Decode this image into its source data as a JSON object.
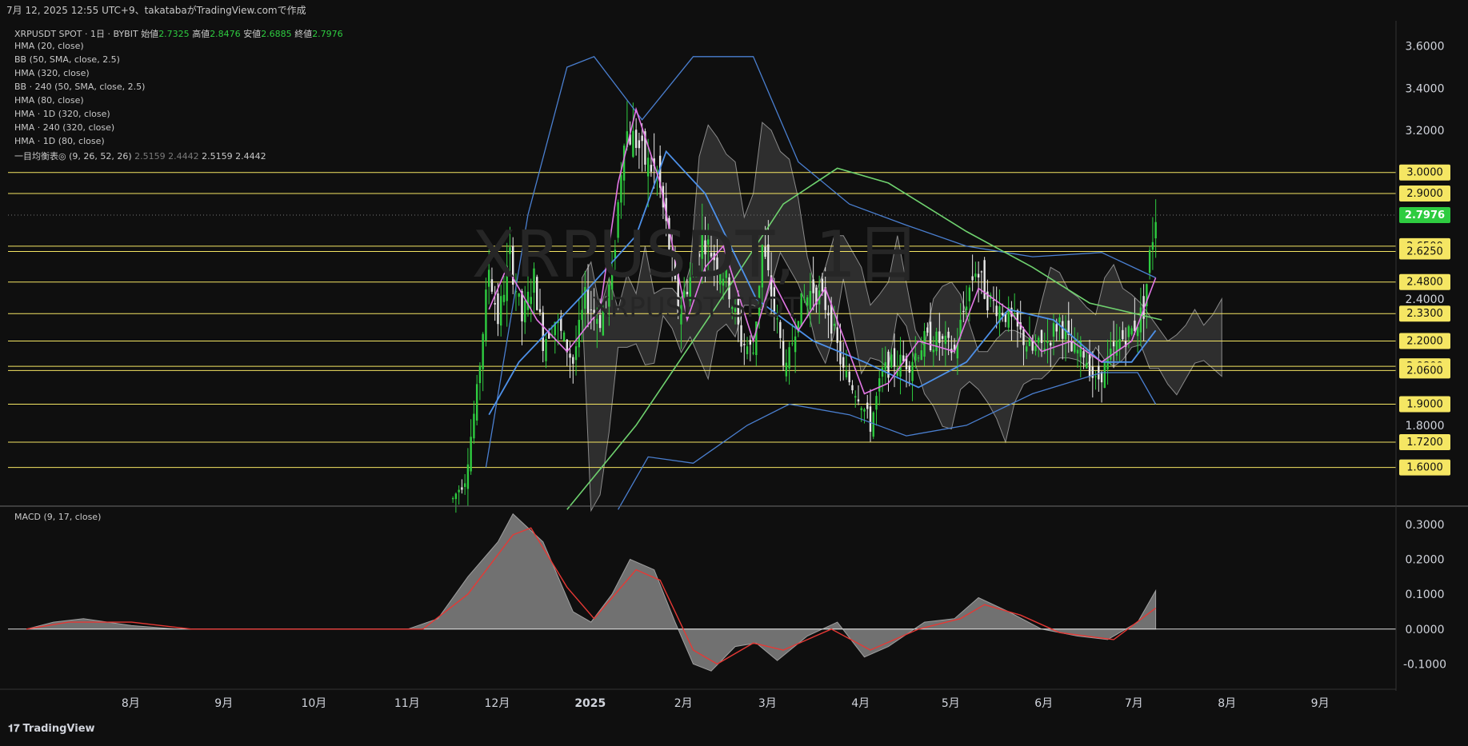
{
  "header": {
    "caption": "7月 12, 2025 12:55 UTC+9、takatabaがTradingView.comで作成"
  },
  "legend": {
    "symbol": "XRPUSDT SPOT · 1日 · BYBIT",
    "open_label": "始値",
    "open": "2.7325",
    "high_label": "高値",
    "high": "2.8476",
    "low_label": "安値",
    "low": "2.6885",
    "close_label": "終値",
    "close": "2.7976",
    "indicators": [
      "HMA (20, close)",
      "BB (50, SMA, close, 2.5)",
      "HMA (320, close)",
      "BB · 240 (50, SMA, close, 2.5)",
      "HMA (80, close)",
      "HMA · 1D (320, close)",
      "HMA · 240 (320, close)",
      "HMA · 1D (80, close)"
    ],
    "ichimoku": {
      "label": "一目均衡表◎ (9, 26, 52, 26)",
      "v1": "2.5159",
      "v2": "2.4442",
      "v3": "2.5159",
      "v4": "2.4442"
    },
    "macd_label": "MACD (9, 17, close)"
  },
  "watermark": {
    "line1": "XRPUSDT, 1日",
    "line2": "XRPUSDT SPOT"
  },
  "footer": {
    "brand": "TradingView"
  },
  "colors": {
    "hline": "#f5e663",
    "up": "#2ecc40",
    "down": "#e8e8e8",
    "hma20": "#e377e6",
    "hma80": "#4d90e8",
    "hma320": "#6fd26f",
    "bb": "#4a7fd0",
    "signal": "#e53935",
    "cloud": "#3a3a3a"
  },
  "chart_data": [
    {
      "type": "candlestick",
      "symbol": "XRPUSDT",
      "x_axis_labels": [
        "8月",
        "9月",
        "10月",
        "11月",
        "12月",
        "2025",
        "2月",
        "3月",
        "4月",
        "5月",
        "6月",
        "7月",
        "8月",
        "9月"
      ],
      "y_axis_ticks": [
        "3.6000",
        "3.4000",
        "3.2000",
        "2.4000",
        "1.8000"
      ],
      "y_range": [
        1.42,
        3.72
      ],
      "price_lines": [
        {
          "value": 3.0,
          "label": "3.0000"
        },
        {
          "value": 2.9,
          "label": "2.9000"
        },
        {
          "value": 2.65,
          "label": "2.6500"
        },
        {
          "value": 2.625,
          "label": "2.6250"
        },
        {
          "value": 2.48,
          "label": "2.4800"
        },
        {
          "value": 2.33,
          "label": "2.3300"
        },
        {
          "value": 2.2,
          "label": "2.2000"
        },
        {
          "value": 2.08,
          "label": "2.0800"
        },
        {
          "value": 2.06,
          "label": "2.0600"
        },
        {
          "value": 1.9,
          "label": "1.9000"
        },
        {
          "value": 1.72,
          "label": "1.7200"
        },
        {
          "value": 1.6,
          "label": "1.6000"
        }
      ],
      "last_price": {
        "value": 2.7976,
        "label": "2.7976"
      },
      "price_path": [
        [
          "2024-11-20",
          1.45
        ],
        [
          "2024-11-24",
          1.55
        ],
        [
          "2024-11-28",
          1.95
        ],
        [
          "2024-12-02",
          2.55
        ],
        [
          "2024-12-05",
          2.3
        ],
        [
          "2024-12-09",
          2.6
        ],
        [
          "2024-12-13",
          2.3
        ],
        [
          "2024-12-17",
          2.5
        ],
        [
          "2024-12-20",
          2.2
        ],
        [
          "2024-12-24",
          2.3
        ],
        [
          "2024-12-30",
          2.1
        ],
        [
          "2025-01-03",
          2.4
        ],
        [
          "2025-01-08",
          2.3
        ],
        [
          "2025-01-12",
          2.5
        ],
        [
          "2025-01-16",
          3.2
        ],
        [
          "2025-01-20",
          3.15
        ],
        [
          "2025-01-23",
          3.05
        ],
        [
          "2025-01-27",
          3.0
        ],
        [
          "2025-01-31",
          2.65
        ],
        [
          "2025-02-03",
          2.35
        ],
        [
          "2025-02-07",
          2.5
        ],
        [
          "2025-02-11",
          2.7
        ],
        [
          "2025-02-15",
          2.6
        ],
        [
          "2025-02-19",
          2.5
        ],
        [
          "2025-02-24",
          2.2
        ],
        [
          "2025-02-28",
          2.15
        ],
        [
          "2025-03-03",
          2.65
        ],
        [
          "2025-03-07",
          2.35
        ],
        [
          "2025-03-11",
          2.05
        ],
        [
          "2025-03-15",
          2.35
        ],
        [
          "2025-03-20",
          2.45
        ],
        [
          "2025-03-25",
          2.35
        ],
        [
          "2025-03-30",
          2.05
        ],
        [
          "2025-04-04",
          1.95
        ],
        [
          "2025-04-08",
          1.8
        ],
        [
          "2025-04-12",
          2.05
        ],
        [
          "2025-04-16",
          2.1
        ],
        [
          "2025-04-21",
          2.1
        ],
        [
          "2025-04-26",
          2.2
        ],
        [
          "2025-05-01",
          2.2
        ],
        [
          "2025-05-06",
          2.15
        ],
        [
          "2025-05-10",
          2.4
        ],
        [
          "2025-05-13",
          2.55
        ],
        [
          "2025-05-17",
          2.4
        ],
        [
          "2025-05-22",
          2.35
        ],
        [
          "2025-05-27",
          2.25
        ],
        [
          "2025-06-01",
          2.15
        ],
        [
          "2025-06-06",
          2.2
        ],
        [
          "2025-06-10",
          2.3
        ],
        [
          "2025-06-14",
          2.15
        ],
        [
          "2025-06-18",
          2.15
        ],
        [
          "2025-06-22",
          2.0
        ],
        [
          "2025-06-26",
          2.1
        ],
        [
          "2025-06-30",
          2.2
        ],
        [
          "2025-07-04",
          2.25
        ],
        [
          "2025-07-08",
          2.35
        ],
        [
          "2025-07-10",
          2.6
        ],
        [
          "2025-07-12",
          2.8
        ]
      ],
      "hma20": [
        [
          "2024-12-02",
          2.35
        ],
        [
          "2024-12-08",
          2.55
        ],
        [
          "2024-12-18",
          2.3
        ],
        [
          "2024-12-28",
          2.15
        ],
        [
          "2025-01-08",
          2.35
        ],
        [
          "2025-01-14",
          2.95
        ],
        [
          "2025-01-20",
          3.3
        ],
        [
          "2025-01-28",
          2.95
        ],
        [
          "2025-02-06",
          2.3
        ],
        [
          "2025-02-12",
          2.55
        ],
        [
          "2025-02-18",
          2.65
        ],
        [
          "2025-02-28",
          2.2
        ],
        [
          "2025-03-06",
          2.5
        ],
        [
          "2025-03-15",
          2.25
        ],
        [
          "2025-03-24",
          2.45
        ],
        [
          "2025-04-06",
          1.95
        ],
        [
          "2025-04-14",
          2.0
        ],
        [
          "2025-04-24",
          2.2
        ],
        [
          "2025-05-06",
          2.15
        ],
        [
          "2025-05-14",
          2.45
        ],
        [
          "2025-05-24",
          2.35
        ],
        [
          "2025-06-04",
          2.15
        ],
        [
          "2025-06-14",
          2.2
        ],
        [
          "2025-06-24",
          2.1
        ],
        [
          "2025-07-04",
          2.2
        ],
        [
          "2025-07-12",
          2.5
        ]
      ],
      "hma80": [
        [
          "2024-12-02",
          1.85
        ],
        [
          "2024-12-12",
          2.1
        ],
        [
          "2025-01-01",
          2.4
        ],
        [
          "2025-01-20",
          2.7
        ],
        [
          "2025-01-30",
          3.1
        ],
        [
          "2025-02-12",
          2.9
        ],
        [
          "2025-03-01",
          2.4
        ],
        [
          "2025-03-20",
          2.2
        ],
        [
          "2025-04-06",
          2.1
        ],
        [
          "2025-04-24",
          1.98
        ],
        [
          "2025-05-10",
          2.1
        ],
        [
          "2025-05-24",
          2.35
        ],
        [
          "2025-06-08",
          2.3
        ],
        [
          "2025-06-24",
          2.1
        ],
        [
          "2025-07-04",
          2.1
        ],
        [
          "2025-07-12",
          2.25
        ]
      ],
      "hma320": [
        [
          "2024-12-28",
          1.4
        ],
        [
          "2025-01-20",
          1.8
        ],
        [
          "2025-02-15",
          2.35
        ],
        [
          "2025-03-10",
          2.85
        ],
        [
          "2025-03-28",
          3.02
        ],
        [
          "2025-04-14",
          2.95
        ],
        [
          "2025-05-10",
          2.72
        ],
        [
          "2025-06-01",
          2.55
        ],
        [
          "2025-06-20",
          2.38
        ],
        [
          "2025-07-14",
          2.3
        ]
      ],
      "bb_upper": [
        [
          "2024-12-01",
          1.6
        ],
        [
          "2024-12-15",
          2.8
        ],
        [
          "2024-12-28",
          3.5
        ],
        [
          "2025-01-06",
          3.55
        ],
        [
          "2025-01-22",
          3.25
        ],
        [
          "2025-02-08",
          3.55
        ],
        [
          "2025-02-28",
          3.55
        ],
        [
          "2025-03-15",
          3.05
        ],
        [
          "2025-04-01",
          2.85
        ],
        [
          "2025-04-20",
          2.75
        ],
        [
          "2025-05-10",
          2.65
        ],
        [
          "2025-06-01",
          2.6
        ],
        [
          "2025-06-24",
          2.62
        ],
        [
          "2025-07-12",
          2.5
        ]
      ],
      "bb_lower": [
        [
          "2025-01-14",
          1.4
        ],
        [
          "2025-01-24",
          1.65
        ],
        [
          "2025-02-08",
          1.62
        ],
        [
          "2025-02-26",
          1.8
        ],
        [
          "2025-03-12",
          1.9
        ],
        [
          "2025-04-01",
          1.85
        ],
        [
          "2025-04-20",
          1.75
        ],
        [
          "2025-05-10",
          1.8
        ],
        [
          "2025-06-01",
          1.95
        ],
        [
          "2025-06-24",
          2.05
        ],
        [
          "2025-07-06",
          2.05
        ],
        [
          "2025-07-12",
          1.9
        ]
      ]
    },
    {
      "type": "area",
      "name": "MACD (9, 17, close)",
      "y_axis_ticks": [
        "0.3000",
        "0.2000",
        "0.1000",
        "0.0000",
        "-0.1000"
      ],
      "y_range": [
        -0.17,
        0.35
      ],
      "macd": [
        [
          "2024-07-01",
          0.0
        ],
        [
          "2024-07-10",
          0.02
        ],
        [
          "2024-07-20",
          0.03
        ],
        [
          "2024-08-05",
          0.01
        ],
        [
          "2024-08-20",
          0.0
        ],
        [
          "2024-09-15",
          0.0
        ],
        [
          "2024-10-15",
          0.0
        ],
        [
          "2024-11-05",
          0.0
        ],
        [
          "2024-11-15",
          0.03
        ],
        [
          "2024-11-25",
          0.15
        ],
        [
          "2024-12-05",
          0.25
        ],
        [
          "2024-12-10",
          0.33
        ],
        [
          "2024-12-20",
          0.25
        ],
        [
          "2024-12-30",
          0.05
        ],
        [
          "2025-01-05",
          0.02
        ],
        [
          "2025-01-12",
          0.1
        ],
        [
          "2025-01-18",
          0.2
        ],
        [
          "2025-01-26",
          0.17
        ],
        [
          "2025-02-02",
          0.02
        ],
        [
          "2025-02-08",
          -0.1
        ],
        [
          "2025-02-14",
          -0.12
        ],
        [
          "2025-02-22",
          -0.05
        ],
        [
          "2025-03-01",
          -0.04
        ],
        [
          "2025-03-08",
          -0.09
        ],
        [
          "2025-03-18",
          -0.02
        ],
        [
          "2025-03-28",
          0.02
        ],
        [
          "2025-04-06",
          -0.08
        ],
        [
          "2025-04-14",
          -0.05
        ],
        [
          "2025-04-26",
          0.02
        ],
        [
          "2025-05-06",
          0.03
        ],
        [
          "2025-05-14",
          0.09
        ],
        [
          "2025-05-24",
          0.05
        ],
        [
          "2025-06-04",
          0.0
        ],
        [
          "2025-06-16",
          -0.02
        ],
        [
          "2025-06-26",
          -0.03
        ],
        [
          "2025-07-06",
          0.02
        ],
        [
          "2025-07-12",
          0.11
        ]
      ],
      "signal": [
        [
          "2024-07-01",
          0.0
        ],
        [
          "2024-07-15",
          0.02
        ],
        [
          "2024-08-05",
          0.02
        ],
        [
          "2024-08-25",
          0.0
        ],
        [
          "2024-11-10",
          0.0
        ],
        [
          "2024-11-25",
          0.1
        ],
        [
          "2024-12-10",
          0.27
        ],
        [
          "2024-12-16",
          0.29
        ],
        [
          "2024-12-28",
          0.12
        ],
        [
          "2025-01-06",
          0.03
        ],
        [
          "2025-01-20",
          0.17
        ],
        [
          "2025-01-28",
          0.14
        ],
        [
          "2025-02-08",
          -0.06
        ],
        [
          "2025-02-16",
          -0.1
        ],
        [
          "2025-02-28",
          -0.04
        ],
        [
          "2025-03-10",
          -0.06
        ],
        [
          "2025-03-26",
          0.0
        ],
        [
          "2025-04-08",
          -0.06
        ],
        [
          "2025-04-24",
          0.0
        ],
        [
          "2025-05-08",
          0.03
        ],
        [
          "2025-05-16",
          0.07
        ],
        [
          "2025-05-28",
          0.04
        ],
        [
          "2025-06-10",
          -0.01
        ],
        [
          "2025-06-28",
          -0.03
        ],
        [
          "2025-07-12",
          0.06
        ]
      ]
    }
  ]
}
